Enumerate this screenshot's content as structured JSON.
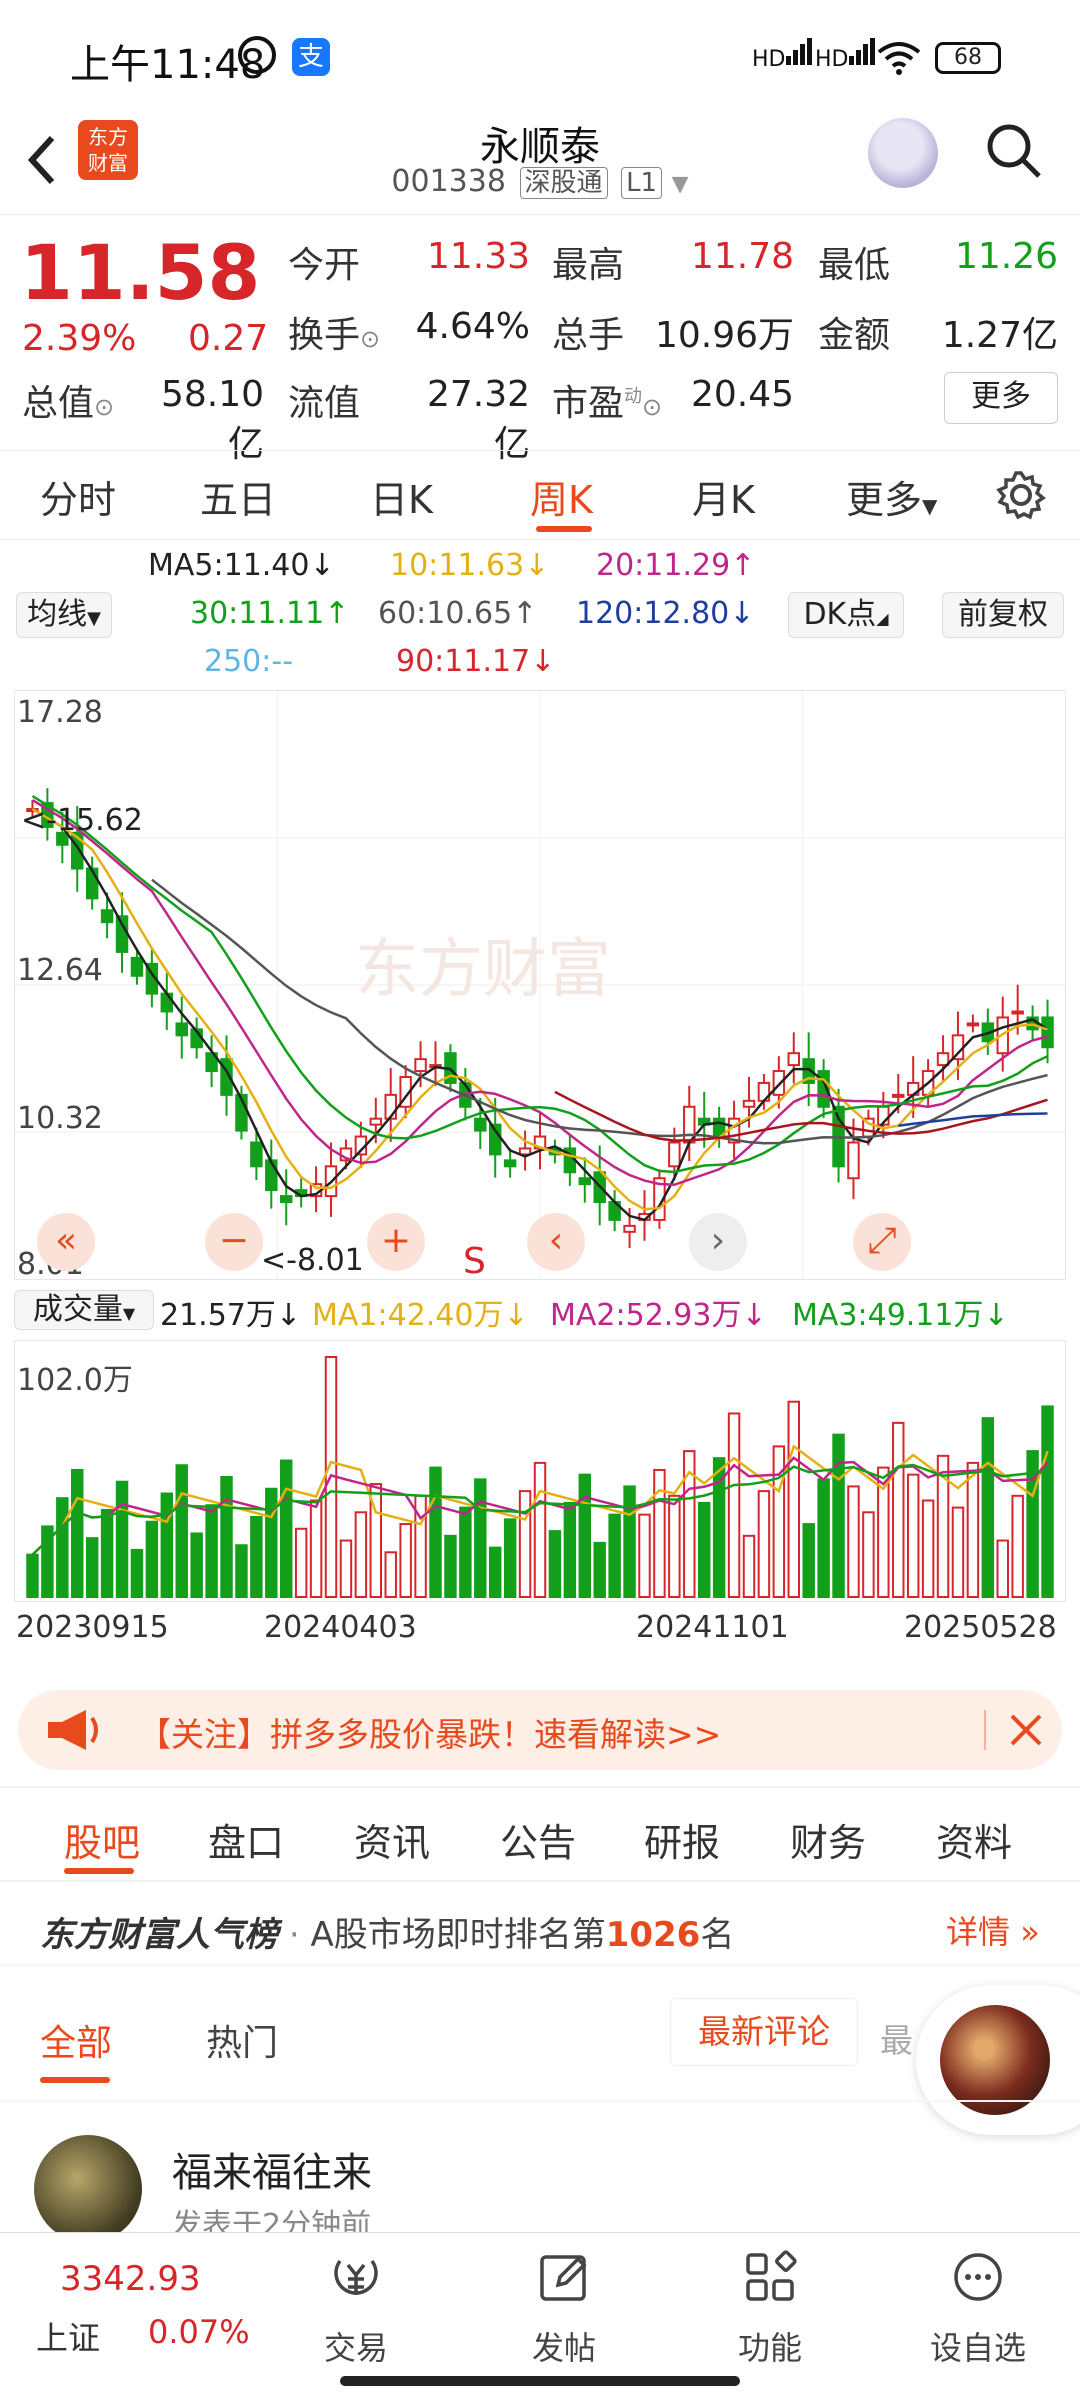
{
  "status_bar": {
    "time": "上午11:48",
    "pay_icon": "支",
    "signal1": "HD",
    "signal2": "HD",
    "battery": "68"
  },
  "header": {
    "logo": "东方财富",
    "stock_name": "永顺泰",
    "stock_code": "001338",
    "market_tag": "深股通",
    "level_tag": "L1"
  },
  "quote": {
    "price": "11.58",
    "change_pct": "2.39%",
    "change": "0.27",
    "open_label": "今开",
    "open": "11.33",
    "high_label": "最高",
    "high": "11.78",
    "low_label": "最低",
    "low": "11.26",
    "turnover_label": "换手",
    "turnover": "4.64%",
    "volume_label": "总手",
    "volume": "10.96万",
    "amount_label": "金额",
    "amount": "1.27亿",
    "mktcap_label": "总值",
    "mktcap": "58.10亿",
    "float_label": "流值",
    "float": "27.32亿",
    "pe_label": "市盈",
    "pe_sup": "动",
    "pe": "20.45",
    "more_button": "更多"
  },
  "period_tabs": [
    "分时",
    "五日",
    "日K",
    "周K",
    "月K",
    "更多"
  ],
  "active_period": "周K",
  "ma_legend": {
    "type_select": "均线",
    "ma5": "MA5:11.40↓",
    "ma10": "10:11.63↓",
    "ma20": "20:11.29↑",
    "ma30": "30:11.11↑",
    "ma60": "60:10.65↑",
    "ma120": "120:12.80↓",
    "ma250": "250:--",
    "ma90": "90:11.17↓",
    "dk_button": "DK点",
    "adjust_button": "前复权"
  },
  "chart_labels": {
    "y_top": "17.28",
    "y_2": "12.64",
    "y_3": "10.32",
    "y_bottom": "8.01",
    "max_marker": "<-15.62",
    "min_marker": "<-8.01",
    "signal_s": "S",
    "watermark": "东方财富"
  },
  "volume": {
    "type_select": "成交量",
    "current": "21.57万↓",
    "ma1": "MA1:42.40万↓",
    "ma2": "MA2:52.93万↓",
    "ma3": "MA3:49.11万↓",
    "y_top": "102.0万"
  },
  "dates": [
    "20230915",
    "20240403",
    "20241101",
    "20250528"
  ],
  "banner": {
    "text": "【关注】拼多多股价暴跌！速看解读>>"
  },
  "content_tabs": [
    "股吧",
    "盘口",
    "资讯",
    "公告",
    "研报",
    "财务",
    "资料"
  ],
  "rank": {
    "brand": "东方财富人气榜",
    "text_prefix": "A股市场即时排名第",
    "rank": "1026",
    "text_suffix": "名",
    "detail": "详情"
  },
  "sub_tabs": {
    "all": "全部",
    "hot": "热门",
    "latest_comment": "最新评论",
    "cut_label": "最"
  },
  "post": {
    "author": "福来福往来",
    "time": "发表于2分钟前"
  },
  "bottom_nav": {
    "index_value": "3342.93",
    "index_name": "上证",
    "index_change": "0.07%",
    "items": [
      "交易",
      "发帖",
      "功能",
      "设自选"
    ]
  },
  "colors": {
    "accent": "#e8491d",
    "up": "#d7262a",
    "down": "#12a01b"
  },
  "chart_data": {
    "type": "candlestick",
    "ylim": [
      8.01,
      17.28
    ],
    "y_ticks": [
      17.28,
      12.64,
      10.32,
      8.01
    ],
    "x_ticks": [
      "20230915",
      "20240403",
      "20241101",
      "20250528"
    ],
    "max_marker": 15.62,
    "min_marker": 8.01,
    "close_path": [
      15.6,
      15.3,
      15.0,
      14.6,
      14.1,
      13.7,
      13.2,
      12.8,
      12.5,
      12.2,
      11.8,
      11.6,
      11.2,
      10.8,
      10.2,
      9.6,
      9.2,
      9.0,
      9.1,
      9.3,
      9.6,
      9.9,
      10.1,
      10.4,
      10.8,
      11.1,
      11.4,
      11.3,
      11.0,
      10.6,
      10.2,
      9.8,
      9.6,
      9.9,
      10.1,
      9.8,
      9.5,
      9.3,
      9.0,
      8.7,
      8.6,
      8.8,
      9.4,
      10.0,
      10.6,
      10.3,
      10.1,
      10.4,
      10.7,
      11.0,
      11.2,
      11.5,
      11.0,
      10.6,
      9.6,
      10.0,
      10.4,
      10.6,
      10.8,
      11.0,
      11.2,
      11.5,
      11.8,
      12.0,
      11.7,
      12.1,
      12.2,
      11.9,
      11.6
    ],
    "volume_ma_levels": {
      "MA1": 42.4,
      "MA2": 52.93,
      "MA3": 49.11
    },
    "volume_max": 102.0
  }
}
